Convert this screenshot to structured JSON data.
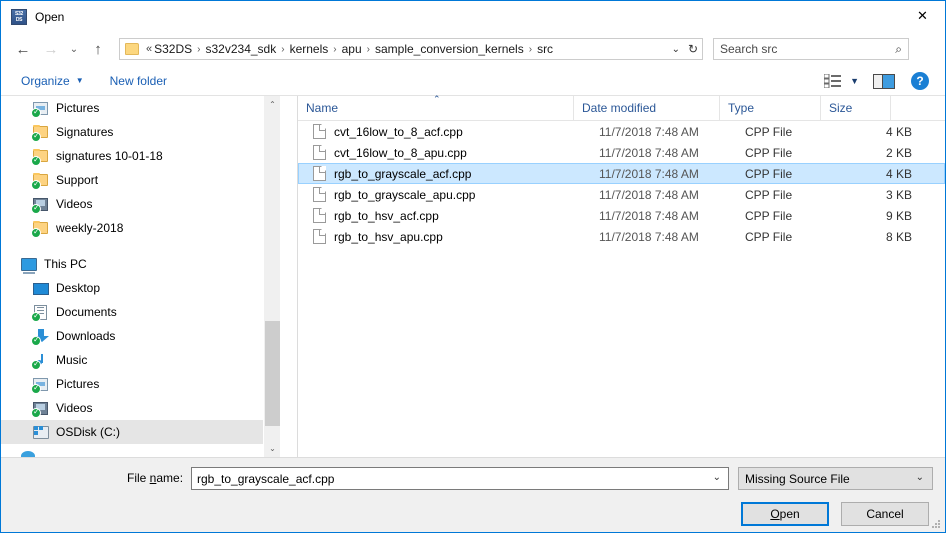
{
  "window": {
    "title": "Open",
    "icon": "s32ds-icon",
    "icon_line1": "S32",
    "icon_line2": "DS",
    "close_label": "✕"
  },
  "nav": {
    "back_icon": "←",
    "forward_icon": "→",
    "recent_icon": "⌄",
    "up_icon": "↑",
    "breadcrumb_prefix": "«",
    "breadcrumb_separator": "›",
    "breadcrumb": [
      "S32DS",
      "s32v234_sdk",
      "kernels",
      "apu",
      "sample_conversion_kernels",
      "src"
    ],
    "breadcrumb_dropdown_icon": "⌄",
    "refresh_icon": "↻"
  },
  "search": {
    "placeholder": "Search src",
    "value": "",
    "icon": "⌕"
  },
  "toolbar": {
    "organize_label": "Organize",
    "organize_caret": "▼",
    "new_folder_label": "New folder",
    "view_caret": "▼",
    "help_label": "?"
  },
  "sidebar": {
    "items": [
      {
        "label": "Pictures",
        "icon": "pictures-icon",
        "indent": "child",
        "synced": true,
        "selected": false
      },
      {
        "label": "Signatures",
        "icon": "folder-icon",
        "indent": "child",
        "synced": true,
        "selected": false
      },
      {
        "label": "signatures 10-01-18",
        "icon": "folder-icon",
        "indent": "child",
        "synced": true,
        "selected": false
      },
      {
        "label": "Support",
        "icon": "folder-icon",
        "indent": "child",
        "synced": true,
        "selected": false
      },
      {
        "label": "Videos",
        "icon": "videos-icon",
        "indent": "child",
        "synced": true,
        "selected": false
      },
      {
        "label": "weekly-2018",
        "icon": "folder-icon",
        "indent": "child",
        "synced": true,
        "selected": false
      },
      {
        "label": "",
        "icon": "spacer",
        "indent": "spacer",
        "synced": false,
        "selected": false
      },
      {
        "label": "This PC",
        "icon": "this-pc-icon",
        "indent": "root",
        "synced": false,
        "selected": false
      },
      {
        "label": "Desktop",
        "icon": "desktop-icon",
        "indent": "child",
        "synced": false,
        "selected": false
      },
      {
        "label": "Documents",
        "icon": "documents-icon",
        "indent": "child",
        "synced": true,
        "selected": false
      },
      {
        "label": "Downloads",
        "icon": "downloads-icon",
        "indent": "child",
        "synced": true,
        "selected": false
      },
      {
        "label": "Music",
        "icon": "music-icon",
        "indent": "child",
        "synced": true,
        "selected": false
      },
      {
        "label": "Pictures",
        "icon": "pictures-icon",
        "indent": "child",
        "synced": true,
        "selected": false
      },
      {
        "label": "Videos",
        "icon": "videos-icon",
        "indent": "child",
        "synced": true,
        "selected": false
      },
      {
        "label": "OSDisk (C:)",
        "icon": "drive-icon",
        "indent": "child",
        "synced": false,
        "selected": true
      },
      {
        "label": "",
        "icon": "network-icon",
        "indent": "root",
        "synced": false,
        "selected": false
      }
    ],
    "scroll_up_icon": "⌃",
    "scroll_down_icon": "⌄"
  },
  "filelist": {
    "columns": {
      "name": "Name",
      "date_modified": "Date modified",
      "type": "Type",
      "size": "Size"
    },
    "sort_caret": "⌃",
    "rows": [
      {
        "name": "cvt_16low_to_8_acf.cpp",
        "date": "11/7/2018 7:48 AM",
        "type": "CPP File",
        "size": "4 KB",
        "selected": false
      },
      {
        "name": "cvt_16low_to_8_apu.cpp",
        "date": "11/7/2018 7:48 AM",
        "type": "CPP File",
        "size": "2 KB",
        "selected": false
      },
      {
        "name": "rgb_to_grayscale_acf.cpp",
        "date": "11/7/2018 7:48 AM",
        "type": "CPP File",
        "size": "4 KB",
        "selected": true
      },
      {
        "name": "rgb_to_grayscale_apu.cpp",
        "date": "11/7/2018 7:48 AM",
        "type": "CPP File",
        "size": "3 KB",
        "selected": false
      },
      {
        "name": "rgb_to_hsv_acf.cpp",
        "date": "11/7/2018 7:48 AM",
        "type": "CPP File",
        "size": "9 KB",
        "selected": false
      },
      {
        "name": "rgb_to_hsv_apu.cpp",
        "date": "11/7/2018 7:48 AM",
        "type": "CPP File",
        "size": "8 KB",
        "selected": false
      }
    ]
  },
  "footer": {
    "filename_label_pre": "File ",
    "filename_label_underlined": "n",
    "filename_label_post": "ame:",
    "filename_value": "rgb_to_grayscale_acf.cpp",
    "filename_caret": "⌄",
    "filter_value": "Missing Source File",
    "filter_caret": "⌄",
    "open_label_underlined": "O",
    "open_label_rest": "pen",
    "cancel_label": "Cancel"
  },
  "colors": {
    "accent": "#0078d7",
    "selection_fill": "#cce8ff",
    "selection_border": "#99d1ff",
    "link": "#1a5fb4",
    "column_header": "#2b5797",
    "footer_bg": "#f0f0f0"
  }
}
